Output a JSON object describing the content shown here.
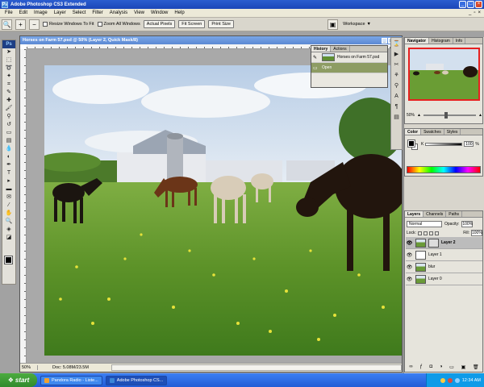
{
  "window": {
    "title": "Adobe Photoshop CS3 Extended",
    "app_icon": "Ps"
  },
  "menu": [
    "File",
    "Edit",
    "Image",
    "Layer",
    "Select",
    "Filter",
    "Analysis",
    "View",
    "Window",
    "Help"
  ],
  "options_bar": {
    "resize_windows": "Resize Windows To Fit",
    "zoom_all": "Zoom All Windows",
    "actual_pixels": "Actual Pixels",
    "fit_screen": "Fit Screen",
    "print_size": "Print Size",
    "workspace": "Workspace"
  },
  "document": {
    "title": "Horses on Farm 57.psd @ 50% (Layer 2, Quick Mask/8)",
    "zoom": "50%",
    "doc_size": "Doc: 5.08M/23.5M"
  },
  "history": {
    "tabs": [
      "History",
      "Actions"
    ],
    "items": [
      {
        "label": "Horses on Farm 57.psd",
        "icon": "snapshot-icon"
      },
      {
        "label": "Open",
        "icon": "history-brush-icon"
      }
    ]
  },
  "navigator": {
    "tabs": [
      "Navigator",
      "Histogram",
      "Info"
    ],
    "zoom": "50%"
  },
  "color": {
    "tabs": [
      "Color",
      "Swatches",
      "Styles"
    ],
    "channel_label": "K",
    "channel_value": "100",
    "channel_unit": "%"
  },
  "layers": {
    "tabs": [
      "Layers",
      "Channels",
      "Paths"
    ],
    "blend_mode": "Normal",
    "opacity_label": "Opacity:",
    "opacity": "100%",
    "lock_label": "Lock:",
    "fill_label": "Fill:",
    "fill": "100%",
    "items": [
      {
        "name": "Layer 2",
        "active": true,
        "thumb": "photo",
        "mask": true
      },
      {
        "name": "Layer 1",
        "active": false,
        "thumb": "blank",
        "mask": false
      },
      {
        "name": "blur",
        "active": false,
        "thumb": "photo",
        "mask": false
      },
      {
        "name": "Layer 0",
        "active": false,
        "thumb": "photo",
        "mask": false
      }
    ]
  },
  "taskbar": {
    "start": "start",
    "tasks": [
      {
        "label": "Pandora Radio - Liste...",
        "active": false
      },
      {
        "label": "Adobe Photoshop CS...",
        "active": true
      }
    ],
    "clock": "12:34 AM"
  }
}
